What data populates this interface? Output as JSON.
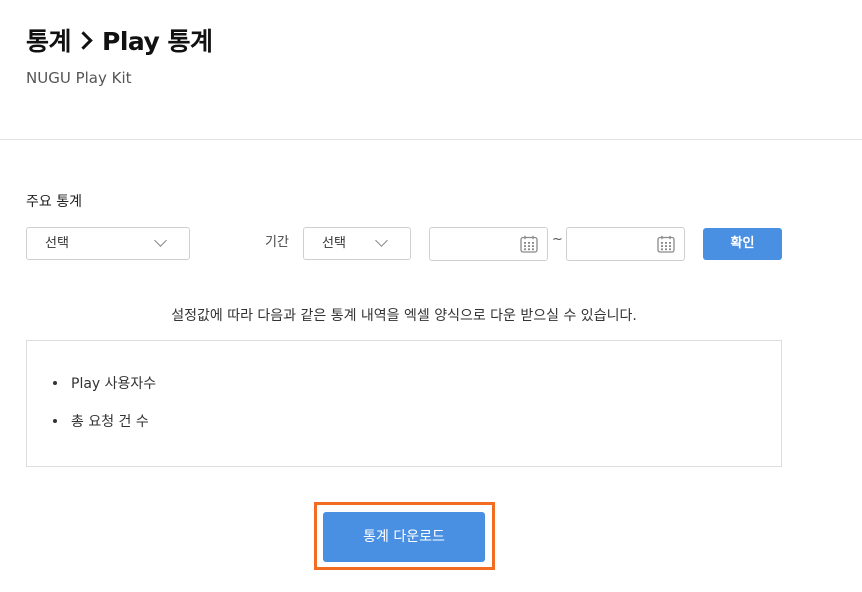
{
  "header": {
    "title_part1": "통계",
    "title_part2": "Play 통계",
    "subtitle": "NUGU Play Kit"
  },
  "filters": {
    "section_label": "주요 통계",
    "main_select_value": "선택",
    "period_label": "기간",
    "period_select_value": "선택",
    "start_date_value": "",
    "end_date_value": "",
    "range_separator": "~",
    "confirm_label": "확인"
  },
  "notice": "설정값에 따라 다음과 같은 통계 내역을 엑셀 양식으로 다운 받으실 수 있습니다.",
  "stat_items": [
    "Play 사용자수",
    "총 요청 건 수"
  ],
  "download_label": "통계 다운로드",
  "colors": {
    "accent": "#4a90e2",
    "highlight": "#f26d21",
    "border": "#cfcfcf"
  },
  "icons": {
    "breadcrumb": "chevron-right-icon",
    "select": "chevron-down-icon",
    "date": "calendar-icon"
  }
}
